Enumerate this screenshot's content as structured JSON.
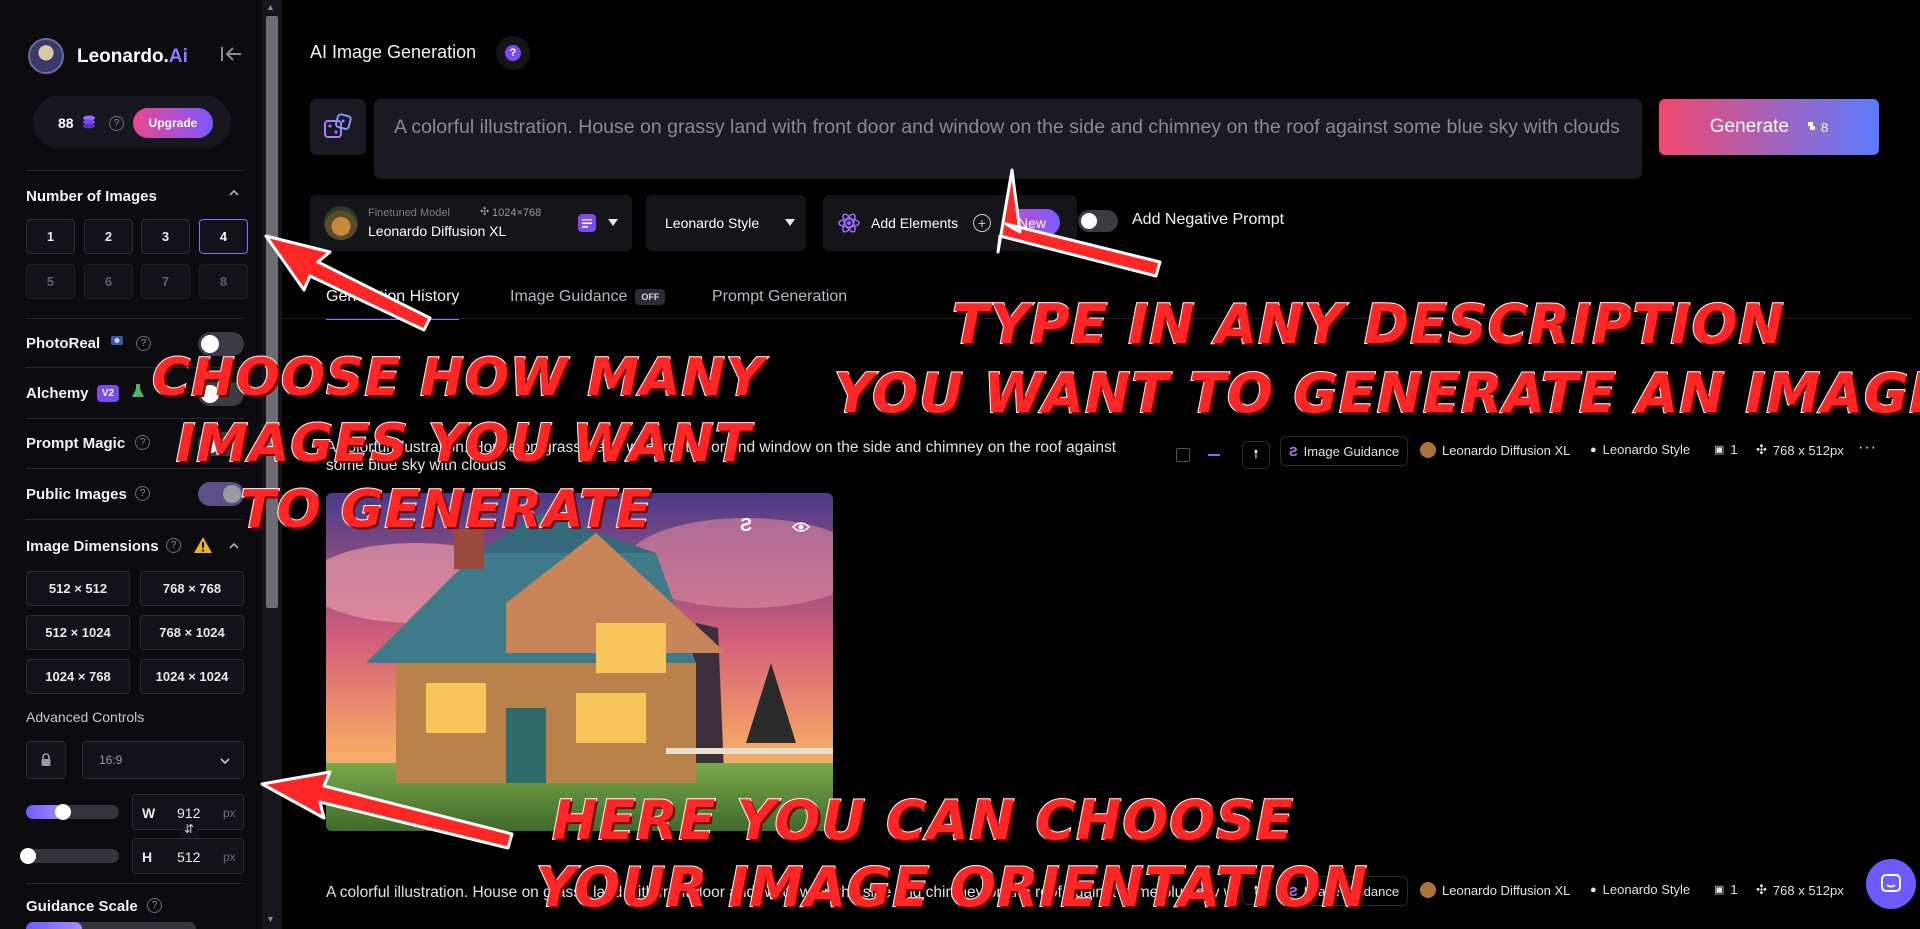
{
  "brand": {
    "name": "Leonardo.",
    "accent": "Ai"
  },
  "credits": {
    "count": "88",
    "upgrade_label": "Upgrade"
  },
  "sidebar": {
    "number_of_images": {
      "label": "Number of Images",
      "options": [
        "1",
        "2",
        "3",
        "4",
        "5",
        "6",
        "7",
        "8"
      ],
      "selected": "4"
    },
    "photoreal": {
      "label": "PhotoReal",
      "enabled": false
    },
    "alchemy": {
      "label": "Alchemy",
      "badge": "V2"
    },
    "prompt_magic": {
      "label": "Prompt Magic"
    },
    "public_images": {
      "label": "Public Images",
      "enabled": true
    },
    "image_dimensions": {
      "label": "Image Dimensions",
      "options": [
        "512 × 512",
        "768 × 768",
        "512 × 1024",
        "768 × 1024",
        "1024 × 768",
        "1024 × 1024"
      ]
    },
    "advanced_controls": {
      "label": "Advanced Controls",
      "aspect_ratio": "16:9"
    },
    "width": {
      "label": "W",
      "value": "912",
      "unit": "px"
    },
    "height": {
      "label": "H",
      "value": "512",
      "unit": "px"
    },
    "guidance_scale": {
      "label": "Guidance Scale"
    }
  },
  "header": {
    "title": "AI Image Generation"
  },
  "prompt": {
    "value": "A colorful illustration. House on grassy land with front door and window on the side and chimney on the root against some blue sky with clouds",
    "display": "A colorful illustration. House on grassy land with front door and window on the side and chimney on the roof against some blue sky with clouds"
  },
  "generate": {
    "label": "Generate",
    "cost": "8"
  },
  "model": {
    "caption": "Finetuned Model",
    "size": "1024×768",
    "name": "Leonardo Diffusion XL"
  },
  "style": {
    "label": "Leonardo Style"
  },
  "elements": {
    "label": "Add Elements",
    "badge": "New"
  },
  "negative_prompt": {
    "label": "Add Negative Prompt"
  },
  "tabs": [
    {
      "label": "Generation History"
    },
    {
      "label": "Image Guidance",
      "badge": "OFF"
    },
    {
      "label": "Prompt Generation"
    }
  ],
  "generations": [
    {
      "prompt_line1": "A colorful illustration. House on grassy land with front door and window on the side and chimney on the roof against",
      "prompt_line2": "some blue sky with clouds",
      "tags": {
        "guidance": "Image Guidance",
        "model": "Leonardo Diffusion XL",
        "style": "Leonardo Style",
        "count": "1",
        "size": "768 x 512px"
      }
    },
    {
      "prompt_line1": "A colorful illustration. House on grassy land with front door and window on the side and chimney on the roof against some blue sky with clouds",
      "tags": {
        "guidance": "Image Guidance",
        "model": "Leonardo Diffusion XL",
        "style": "Leonardo Style",
        "count": "1",
        "size": "768 x 512px"
      }
    }
  ],
  "annotations": {
    "images_line1": "Choose how many",
    "images_line2": "images you want",
    "images_line3": "to generate",
    "prompt_line1": "Type in any description",
    "prompt_line2": "you want to generate an image",
    "orientation_line1": "Here you can choose",
    "orientation_line2": "your image orientation"
  },
  "colors": {
    "accent": "#7b72ff",
    "generate_start": "#f2486f",
    "generate_end": "#5d7bff",
    "annotation": "#ff2626"
  }
}
